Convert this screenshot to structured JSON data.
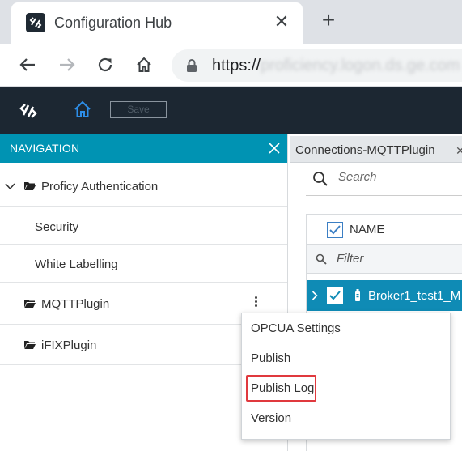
{
  "browser": {
    "tab_title": "Configuration Hub",
    "tab_close_icon": "close-icon",
    "new_tab_icon": "plus-icon",
    "url_scheme": "https://",
    "url_host": "proficiency.logon.ds.ge.com"
  },
  "app": {
    "save_label": "Save"
  },
  "navigation": {
    "header": "NAVIGATION",
    "items": [
      {
        "label": "Proficy Authentication",
        "expanded": true,
        "level": 0
      },
      {
        "label": "Security",
        "level": 1
      },
      {
        "label": "White Labelling",
        "level": 1
      },
      {
        "label": "MQTTPlugin",
        "level": 0
      },
      {
        "label": "iFIXPlugin",
        "level": 0
      }
    ]
  },
  "connections": {
    "tab_title": "Connections-MQTTPlugin",
    "search_placeholder": "Search",
    "column_name": "NAME",
    "filter_placeholder": "Filter",
    "row_label": "Broker1_test1_M"
  },
  "context_menu": {
    "items": [
      "OPCUA Settings",
      "Publish",
      "Publish Log",
      "Version"
    ],
    "highlighted": "Publish Log"
  },
  "colors": {
    "app_header": "#1c2732",
    "nav_header": "#0093b3",
    "selected_row": "#0f8bb5",
    "highlight_box": "#e0393e"
  }
}
